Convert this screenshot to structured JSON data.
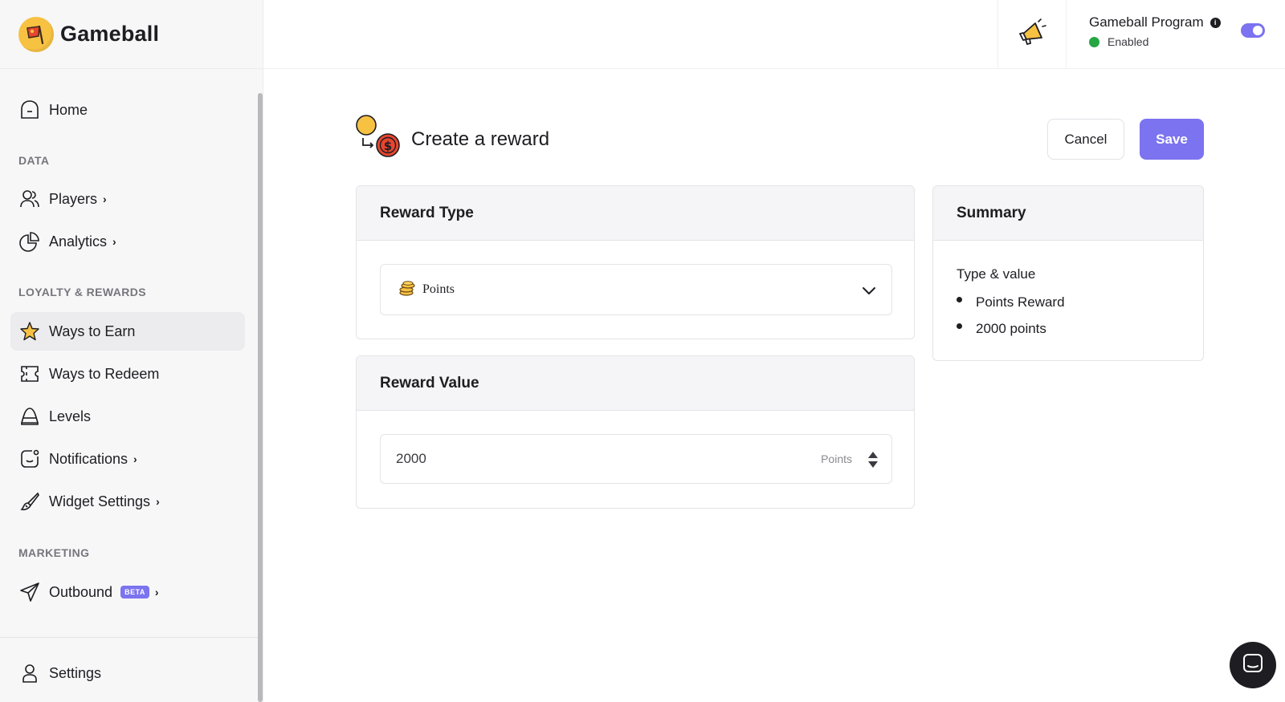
{
  "brand": {
    "name": "Gameball"
  },
  "sidebar": {
    "home": "Home",
    "sections": {
      "data": "DATA",
      "loyalty": "LOYALTY & REWARDS",
      "marketing": "MARKETING"
    },
    "items": {
      "players": "Players",
      "analytics": "Analytics",
      "ways_to_earn": "Ways to Earn",
      "ways_to_redeem": "Ways to Redeem",
      "levels": "Levels",
      "notifications": "Notifications",
      "widget_settings": "Widget Settings",
      "outbound": "Outbound",
      "outbound_badge": "BETA",
      "settings": "Settings"
    },
    "chevron": "›"
  },
  "topbar": {
    "program_title": "Gameball Program",
    "program_status": "Enabled",
    "info_glyph": "i",
    "toggle_on": true
  },
  "page": {
    "title": "Create a reward",
    "cancel_label": "Cancel",
    "save_label": "Save"
  },
  "reward_type": {
    "title": "Reward Type",
    "selected": "Points"
  },
  "reward_value": {
    "title": "Reward Value",
    "value": "2000",
    "unit": "Points"
  },
  "summary": {
    "title": "Summary",
    "subtitle": "Type & value",
    "items": [
      "Points Reward",
      "2000 points"
    ]
  },
  "colors": {
    "accent": "#7b73ef",
    "status_enabled": "#27a644",
    "brand_logo": "#f7c142"
  }
}
